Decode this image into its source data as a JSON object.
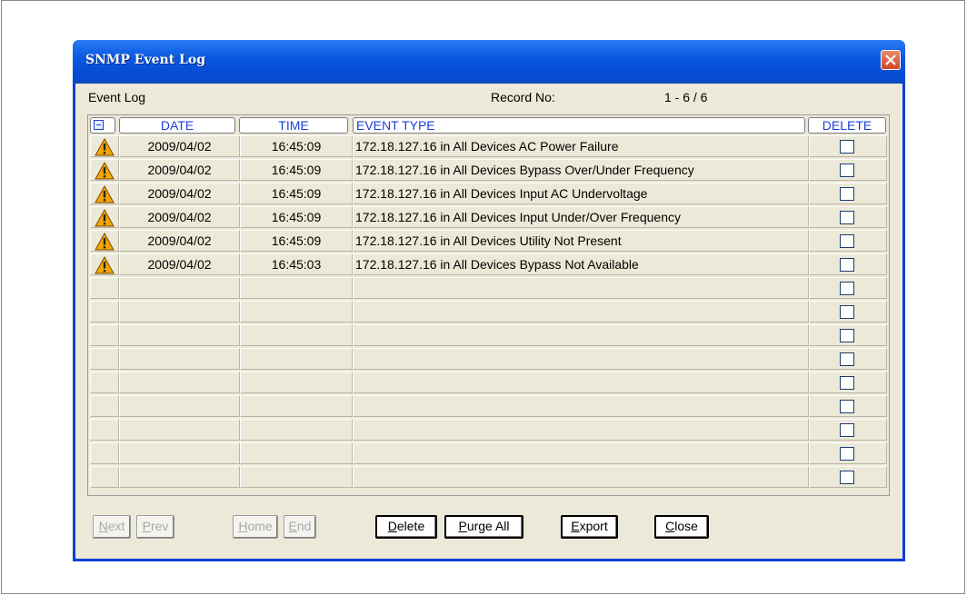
{
  "window": {
    "title": "SNMP Event Log"
  },
  "header": {
    "event_log_label": "Event Log",
    "record_label": "Record No:",
    "record_range": "1 - 6 / 6"
  },
  "columns": {
    "date": "DATE",
    "time": "TIME",
    "event_type": "EVENT TYPE",
    "delete": "DELETE"
  },
  "rows": [
    {
      "icon": "warning-icon",
      "date": "2009/04/02",
      "time": "16:45:09",
      "event": "172.18.127.16 in All Devices AC Power Failure",
      "delete": false
    },
    {
      "icon": "warning-icon",
      "date": "2009/04/02",
      "time": "16:45:09",
      "event": "172.18.127.16 in All Devices Bypass Over/Under Frequency",
      "delete": false
    },
    {
      "icon": "warning-icon",
      "date": "2009/04/02",
      "time": "16:45:09",
      "event": "172.18.127.16 in All Devices Input AC Undervoltage",
      "delete": false
    },
    {
      "icon": "warning-icon",
      "date": "2009/04/02",
      "time": "16:45:09",
      "event": "172.18.127.16 in All Devices Input Under/Over Frequency",
      "delete": false
    },
    {
      "icon": "warning-icon",
      "date": "2009/04/02",
      "time": "16:45:09",
      "event": "172.18.127.16 in All Devices Utility Not Present",
      "delete": false
    },
    {
      "icon": "warning-icon",
      "date": "2009/04/02",
      "time": "16:45:03",
      "event": "172.18.127.16 in All Devices Bypass Not Available",
      "delete": false
    }
  ],
  "buttons": {
    "next": {
      "first": "N",
      "rest": "ext"
    },
    "prev": {
      "first": "P",
      "rest": "rev"
    },
    "home": {
      "first": "H",
      "rest": "ome"
    },
    "end": {
      "first": "E",
      "rest": "nd"
    },
    "delete": {
      "first": "D",
      "rest": "elete"
    },
    "purge_all": {
      "first": "P",
      "rest": "urge All"
    },
    "export": {
      "first": "E",
      "rest": "xport"
    },
    "close": {
      "first": "C",
      "rest": "lose"
    }
  },
  "colors": {
    "title_bar": "#0a58e0",
    "accent": "#1c3fd6",
    "warning": "#f5a700"
  }
}
